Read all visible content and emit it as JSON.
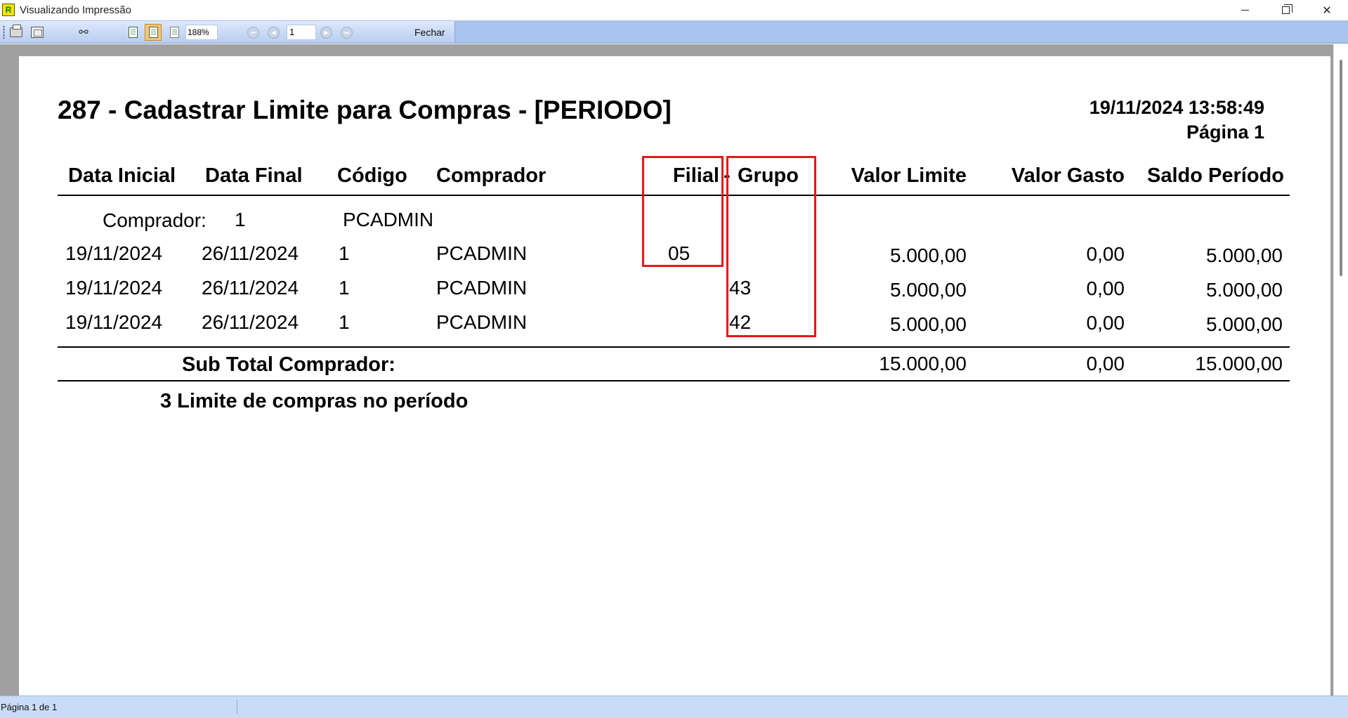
{
  "window": {
    "title": "Visualizando Impressão",
    "app_icon_letter": "R"
  },
  "toolbar": {
    "zoom": "188%",
    "page": "1",
    "close_label": "Fechar"
  },
  "report": {
    "title": "287 - Cadastrar Limite para Compras - [PERIODO]",
    "datetime": "19/11/2024 13:58:49",
    "page_label": "Página 1",
    "headers": {
      "data_inicial": "Data Inicial",
      "data_final": "Data Final",
      "codigo": "Código",
      "comprador": "Comprador",
      "filial": "Filial",
      "grupo_sep": "-",
      "grupo": "Grupo",
      "valor_limite": "Valor Limite",
      "valor_gasto": "Valor Gasto",
      "saldo_periodo": "Saldo Período"
    },
    "group": {
      "label": "Comprador:",
      "code": "1",
      "name": "PCADMIN"
    },
    "rows": [
      {
        "data_inicial": "19/11/2024",
        "data_final": "26/11/2024",
        "codigo": "1",
        "comprador": "PCADMIN",
        "filial": "05",
        "grupo": "",
        "valor_limite": "5.000,00",
        "valor_gasto": "0,00",
        "saldo": "5.000,00"
      },
      {
        "data_inicial": "19/11/2024",
        "data_final": "26/11/2024",
        "codigo": "1",
        "comprador": "PCADMIN",
        "filial": "",
        "grupo": "43",
        "valor_limite": "5.000,00",
        "valor_gasto": "0,00",
        "saldo": "5.000,00"
      },
      {
        "data_inicial": "19/11/2024",
        "data_final": "26/11/2024",
        "codigo": "1",
        "comprador": "PCADMIN",
        "filial": "",
        "grupo": "42",
        "valor_limite": "5.000,00",
        "valor_gasto": "0,00",
        "saldo": "5.000,00"
      }
    ],
    "subtotal": {
      "label": "Sub Total Comprador:",
      "valor_limite": "15.000,00",
      "valor_gasto": "0,00",
      "saldo": "15.000,00"
    },
    "summary": "3 Limite de compras no período"
  },
  "statusbar": {
    "text": "Página 1 de 1"
  },
  "colors": {
    "highlight": "#e6161b",
    "toolbar_bg": "#a9c3ee",
    "preview_bg": "#a0a0a0"
  }
}
